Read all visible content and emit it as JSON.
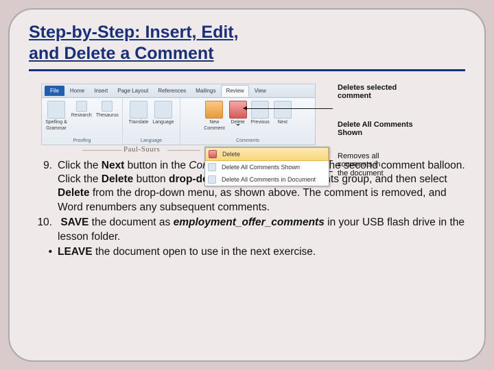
{
  "title_line1": "Step-by-Step: Insert, Edit,",
  "title_line2": "and Delete a Comment",
  "ribbon": {
    "tabs": {
      "file": "File",
      "home": "Home",
      "insert": "Insert",
      "pagelayout": "Page Layout",
      "references": "References",
      "mailings": "Mailings",
      "review": "Review",
      "view": "View"
    },
    "groups": {
      "proofing": {
        "labels": [
          "Spelling &",
          "Grammar",
          "Research",
          "Thesaurus"
        ],
        "name": "Proofing"
      },
      "language": {
        "labels": [
          "Translate",
          "Language"
        ],
        "name": "Language"
      },
      "comments": {
        "labels": [
          "New",
          "Comment",
          "Delete",
          "Previous",
          "Next"
        ],
        "name": "Comments"
      }
    },
    "author": "Paul-Suurs"
  },
  "menu": {
    "item1": "Delete",
    "item2": "Delete All Comments Shown",
    "item3": "Delete All Comments in Document"
  },
  "callouts": {
    "c1a": "Deletes selected",
    "c1b": "comment",
    "c2a": "Delete All Comments",
    "c2b": "Shown",
    "c3a": "Removes all",
    "c3b": "comments in",
    "c3c": "the document"
  },
  "steps": {
    "s9": {
      "num": "9.",
      "t1": "Click the ",
      "b1": "Next",
      "t2": " button in the ",
      "i1": "Comments",
      "t3": " group to move to the second comment balloon. Click the ",
      "b2": "Delete",
      "t4": " button ",
      "b3": "drop-down arrow",
      "t5": " in the Comments group, and then select ",
      "b4": "Delete",
      "t6": " from the drop-down menu, as shown above. The comment is removed, and Word renumbers any subsequent comments."
    },
    "s10": {
      "num": "10.",
      "b1": "SAVE",
      "t1": " the document as ",
      "bi1": "employment_offer_comments",
      "t2": " in your USB flash drive in the lesson folder."
    },
    "s11": {
      "num": "•",
      "b1": "LEAVE",
      "t1": " the document open to use in the next exercise."
    }
  }
}
